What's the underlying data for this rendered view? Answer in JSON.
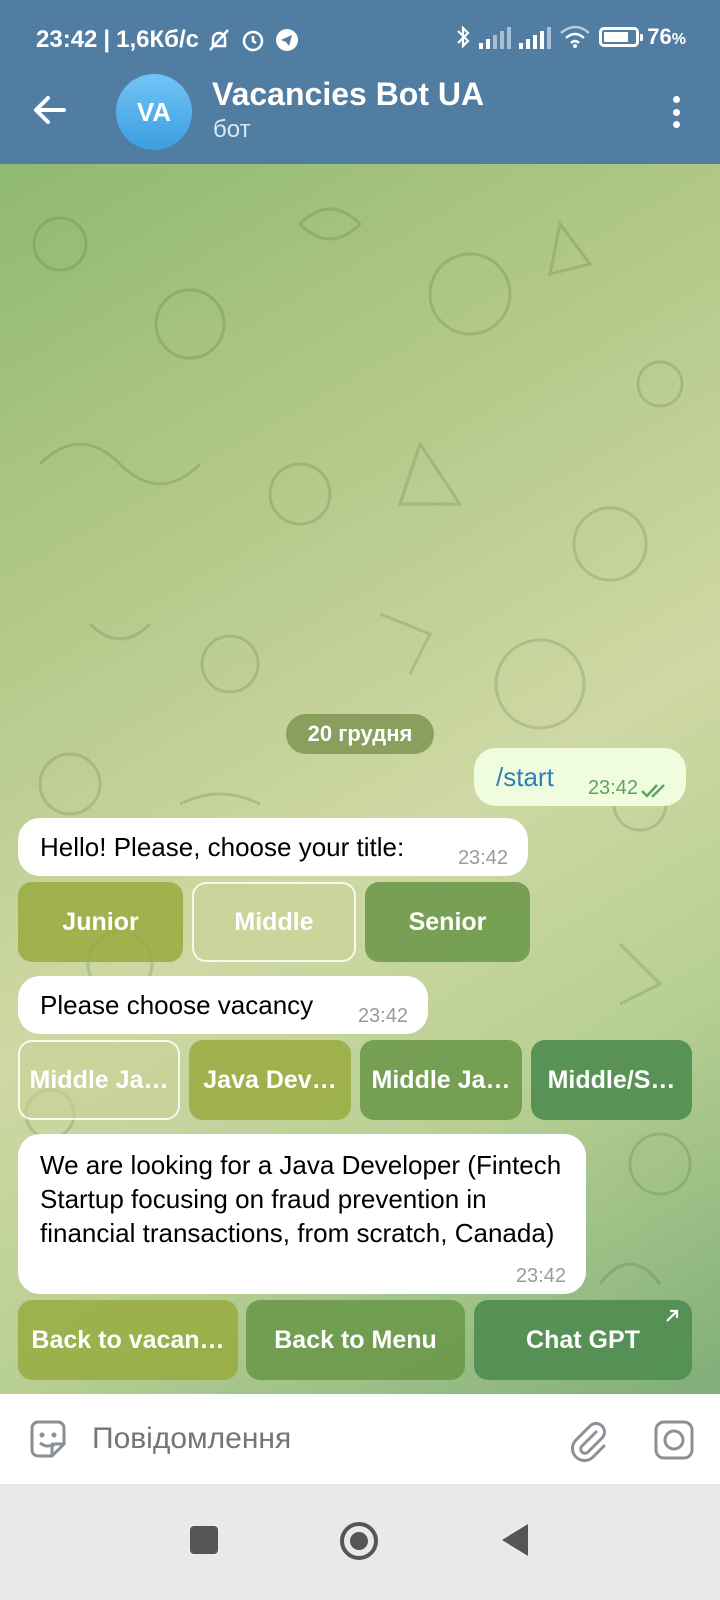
{
  "status_bar": {
    "time": "23:42",
    "network_speed": "1,6Кб/с",
    "battery": "76",
    "battery_unit": "%",
    "network_type": "4G"
  },
  "header": {
    "avatar_initials": "VA",
    "title": "Vacancies Bot UA",
    "subtitle": "бот"
  },
  "chat": {
    "date_separator": "20 грудня",
    "messages": [
      {
        "direction": "out",
        "text": "/start",
        "time": "23:42"
      },
      {
        "direction": "in",
        "text": "Hello! Please, choose your title:",
        "time": "23:42"
      },
      {
        "direction": "in",
        "text": "Please choose vacancy",
        "time": "23:42"
      },
      {
        "direction": "in",
        "text": "We are looking for a Java Developer (Fintech Startup focusing on fraud prevention in financial transactions, from scratch, Canada)",
        "time": "23:42"
      }
    ],
    "title_buttons": [
      "Junior",
      "Middle",
      "Senior"
    ],
    "vacancy_buttons": [
      "Middle Ja…",
      "Java Dev…",
      "Middle Ja…",
      "Middle/S…"
    ],
    "menu_buttons": [
      "Back to vacan…",
      "Back to Menu",
      "Chat GPT"
    ]
  },
  "input": {
    "placeholder": "Повідомлення"
  },
  "colors": {
    "header_bg": "#517DA2",
    "outgoing_bubble": "#effdde",
    "incoming_bubble": "#ffffff",
    "keyboard_button": "#96aa3c"
  }
}
